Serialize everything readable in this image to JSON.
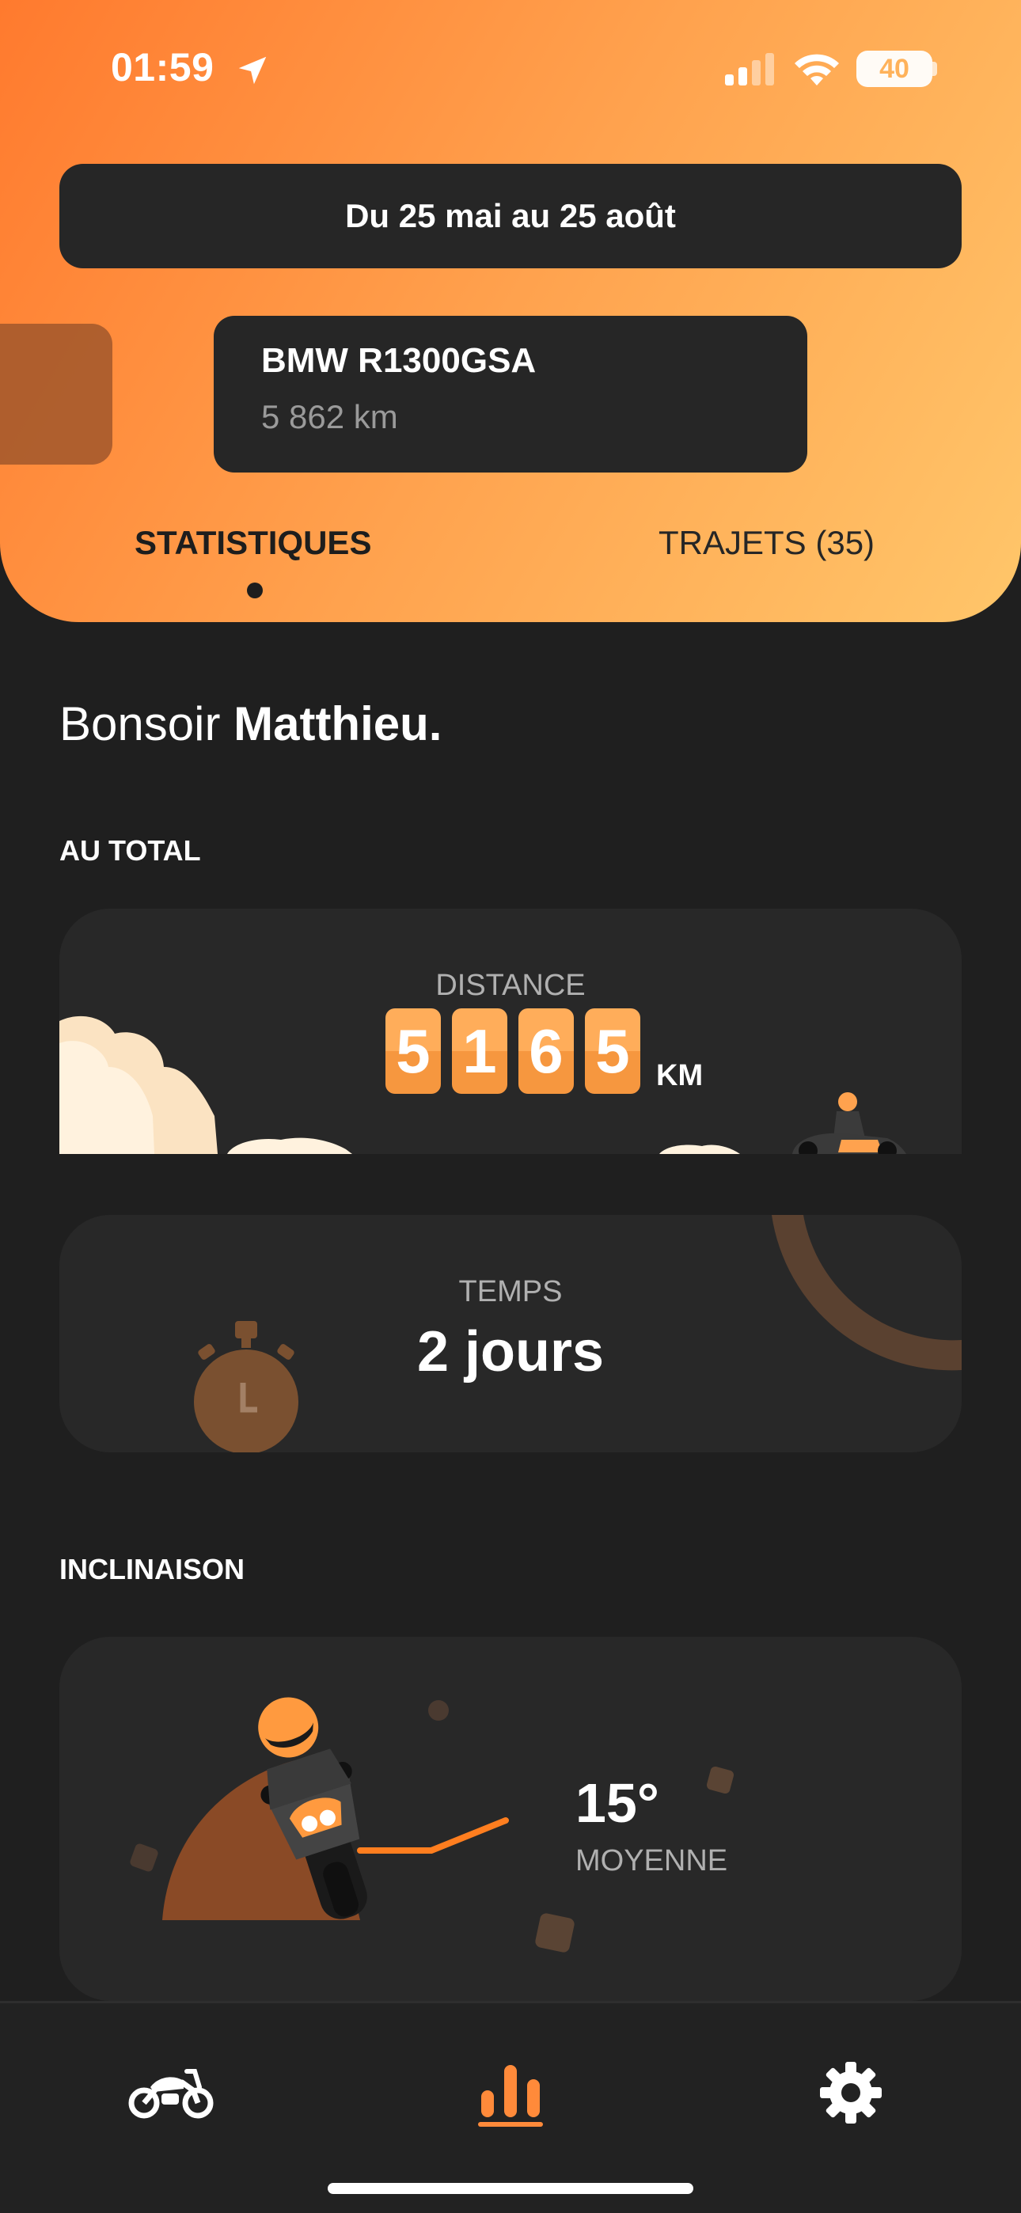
{
  "status_bar": {
    "time": "01:59",
    "battery": "40"
  },
  "header": {
    "date_range": "Du 25 mai au 25 août",
    "bike": {
      "name": "BMW R1300GSA",
      "mileage": "5 862 km"
    },
    "tabs": [
      {
        "label": "STATISTIQUES",
        "active": true
      },
      {
        "label": "TRAJETS (35)",
        "active": false
      }
    ]
  },
  "greeting": {
    "prefix": "Bonsoir ",
    "name": "Matthieu."
  },
  "sections": {
    "total_label": "AU TOTAL",
    "lean_label": "INCLINAISON"
  },
  "distance": {
    "label": "DISTANCE",
    "digits": [
      "5",
      "1",
      "6",
      "5"
    ],
    "unit": "KM"
  },
  "time_stat": {
    "label": "TEMPS",
    "value": "2 jours"
  },
  "lean": {
    "value": "15°",
    "label": "MOYENNE"
  },
  "bottom_nav": [
    {
      "icon": "motorcycle-icon",
      "active": false
    },
    {
      "icon": "bar-chart-icon",
      "active": true
    },
    {
      "icon": "gear-icon",
      "active": false
    }
  ],
  "colors": {
    "accent": "#ff8a3a",
    "background": "#1f1f1f",
    "card": "#282828"
  }
}
